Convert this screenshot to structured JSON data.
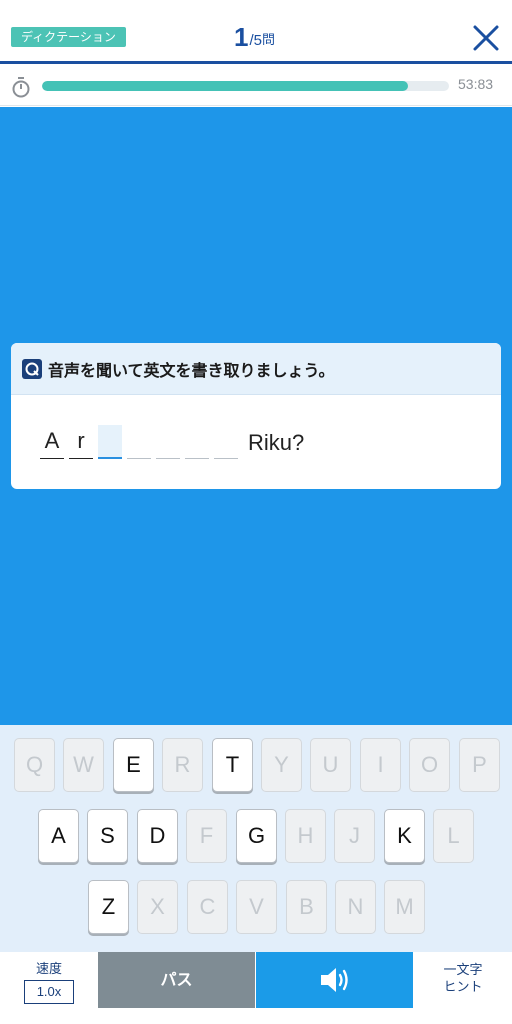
{
  "header": {
    "mode": "ディクテーション",
    "question_current": "1",
    "question_total": "/5",
    "question_unit": "問",
    "close_icon": "close-icon"
  },
  "timer": {
    "icon": "stopwatch-icon",
    "progress_fraction": 0.9,
    "time_left": "53:83"
  },
  "card": {
    "icon": "question-icon",
    "instruction": "音声を聞いて英文を書き取りましょう。",
    "slots": [
      "A",
      "r",
      "",
      "",
      "",
      "",
      ""
    ],
    "active_slot": 2,
    "tail": "Riku?"
  },
  "keyboard": {
    "rows": [
      [
        {
          "label": "Q",
          "enabled": false
        },
        {
          "label": "W",
          "enabled": false
        },
        {
          "label": "E",
          "enabled": true
        },
        {
          "label": "R",
          "enabled": false
        },
        {
          "label": "T",
          "enabled": true
        },
        {
          "label": "Y",
          "enabled": false
        },
        {
          "label": "U",
          "enabled": false
        },
        {
          "label": "I",
          "enabled": false
        },
        {
          "label": "O",
          "enabled": false
        },
        {
          "label": "P",
          "enabled": false
        }
      ],
      [
        {
          "label": "A",
          "enabled": true
        },
        {
          "label": "S",
          "enabled": true
        },
        {
          "label": "D",
          "enabled": true
        },
        {
          "label": "F",
          "enabled": false
        },
        {
          "label": "G",
          "enabled": true
        },
        {
          "label": "H",
          "enabled": false
        },
        {
          "label": "J",
          "enabled": false
        },
        {
          "label": "K",
          "enabled": true
        },
        {
          "label": "L",
          "enabled": false
        }
      ],
      [
        {
          "label": "Z",
          "enabled": true
        },
        {
          "label": "X",
          "enabled": false
        },
        {
          "label": "C",
          "enabled": false
        },
        {
          "label": "V",
          "enabled": false
        },
        {
          "label": "B",
          "enabled": false
        },
        {
          "label": "N",
          "enabled": false
        },
        {
          "label": "M",
          "enabled": false
        }
      ]
    ]
  },
  "bottom": {
    "speed_label": "速度",
    "speed_value": "1.0x",
    "pass_label": "パス",
    "audio_icon": "speaker-icon",
    "hint_line1": "一文字",
    "hint_line2": "ヒント"
  },
  "colors": {
    "accent": "#1a4fa0",
    "stage": "#1e96e9",
    "progress": "#44c2b6",
    "badge": "#4cc3b5",
    "pass": "#7f8c94",
    "audio": "#1b9be8"
  }
}
